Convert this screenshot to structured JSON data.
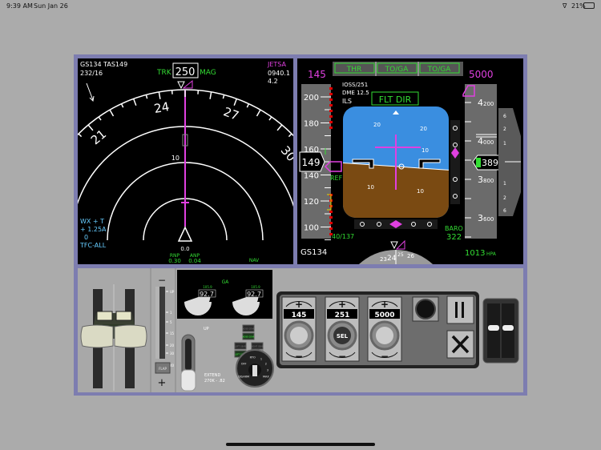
{
  "status_bar": {
    "time": "9:39 AM",
    "date": "Sun Jan 26",
    "battery": "21%",
    "wifi_icon": "wifi-icon",
    "battery_icon": "battery-icon"
  },
  "nd": {
    "gs_tas": "GS134  TAS149",
    "wind": "232/16",
    "trk_label": "TRK",
    "heading": "250",
    "mag_label": "MAG",
    "waypoint": "JETSA",
    "eta": "0940.1",
    "distance": "4.2",
    "compass_labels": [
      {
        "text": "21",
        "hdg": 210
      },
      {
        "text": "24",
        "hdg": 240
      },
      {
        "text": "27",
        "hdg": 270
      },
      {
        "text": "30",
        "hdg": 300
      }
    ],
    "range_label": "10",
    "efis_options": [
      "WX + T",
      "+ 1.25A",
      "0",
      "TFC-ALL"
    ],
    "center_value": "0.0",
    "rnp_label": "RNP",
    "rnp_value": "0.30",
    "anp_label": "ANP",
    "anp_value": "0.04",
    "nav_label": "NAV"
  },
  "pfd": {
    "fma": [
      "THR",
      "TO/GA",
      "TO/GA"
    ],
    "selected_speed": "145",
    "selected_altitude": "5000",
    "ils_ident": "IOSS/251",
    "dme": "DME  12.5",
    "ils_label": "ILS",
    "flt_dir": "FLT DIR",
    "speed_ticks": [
      "200",
      "180",
      "160",
      "140",
      "120",
      "100"
    ],
    "current_speed": "149",
    "ref_label": "REF",
    "v_speeds": "40/137",
    "pitch_labels": [
      "20",
      "20",
      "10",
      "10",
      "10",
      "10"
    ],
    "heading_scale": [
      "23",
      "24",
      "25",
      "26"
    ],
    "alt_ticks": [
      {
        "big": "4",
        "small": "200"
      },
      {
        "big": "4",
        "small": "000"
      },
      {
        "big": "3",
        "small": "800"
      },
      {
        "big": "3",
        "small": "600"
      }
    ],
    "current_altitude": "3890",
    "baro_label": "BARO",
    "baro_value": "322",
    "qnh": "1013",
    "qnh_unit": "HPA",
    "ground_speed": "GS134",
    "vsi_labels": [
      "6",
      "2",
      "1",
      "1",
      "2",
      "6"
    ]
  },
  "flaps": {
    "minus": "−",
    "plus": "+",
    "labels": [
      "UP",
      "1",
      "5",
      "15",
      "20",
      "30",
      "40"
    ],
    "handle_label": "FLAP"
  },
  "engines": {
    "mode": "GA",
    "n1_limit_left": "105.9",
    "n1_limit_right": "105.9",
    "n1_left": "92.7",
    "n1_right": "92.7"
  },
  "gear": {
    "up_label": "UP",
    "extend_label": "EXTEND",
    "extend_speed": "270K - .82",
    "lights": [
      "NOSE GEAR",
      "NOSE GEAR",
      "LEFT GEAR",
      "RIGHT GEAR",
      "LEFT GEAR",
      "RIGHT GEAR"
    ],
    "autobrake": [
      "RTO",
      "OFF",
      "1",
      "2",
      "3",
      "MAX",
      "DISARM"
    ]
  },
  "mcp": {
    "speed": "145",
    "heading": "251",
    "altitude": "5000",
    "sel_label": "SEL",
    "plus": "+",
    "minus": "−"
  },
  "colors": {
    "frame": "#7d7db0",
    "green": "#33dd33",
    "magenta": "#e040e0",
    "cyan": "#66ccff",
    "sky": "#3a8ee0",
    "ground": "#7a4a12"
  }
}
